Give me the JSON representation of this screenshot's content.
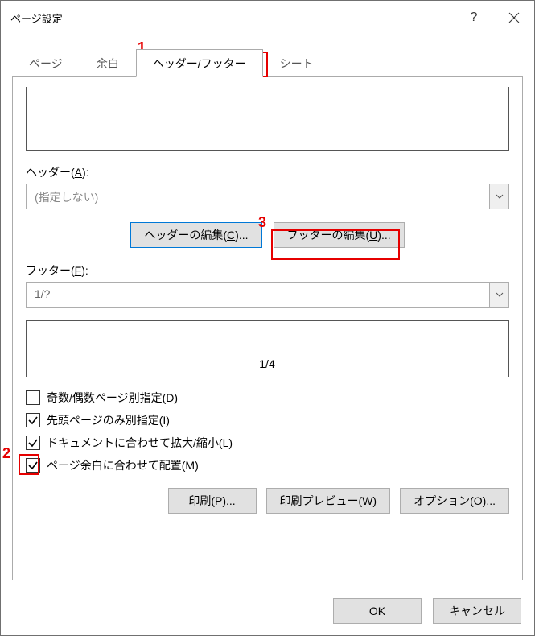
{
  "title": "ページ設定",
  "titlebar": {
    "help": "?",
    "close": "close"
  },
  "tabs": {
    "page": "ページ",
    "margin": "余白",
    "headerfooter": "ヘッダー/フッター",
    "sheet": "シート"
  },
  "header_section": {
    "label_pre": "ヘッダー(",
    "label_key": "A",
    "label_post": "):",
    "combo_value": "(指定しない)",
    "edit_header_pre": "ヘッダーの編集(",
    "edit_header_key": "C",
    "edit_header_post": ")...",
    "edit_footer_pre": "フッターの編集(",
    "edit_footer_key": "U",
    "edit_footer_post": ")..."
  },
  "footer_section": {
    "label_pre": "フッター(",
    "label_key": "F",
    "label_post": "):",
    "combo_value": "1/?",
    "preview": "1/4"
  },
  "checks": {
    "oddeven_pre": "奇数/偶数ページ別指定(",
    "oddeven_key": "D",
    "oddeven_post": ")",
    "firstpage_pre": "先頭ページのみ別指定(",
    "firstpage_key": "I",
    "firstpage_post": ")",
    "scale_pre": "ドキュメントに合わせて拡大/縮小(",
    "scale_key": "L",
    "scale_post": ")",
    "align_pre": "ページ余白に合わせて配置(",
    "align_key": "M",
    "align_post": ")"
  },
  "buttons": {
    "print_pre": "印刷(",
    "print_key": "P",
    "print_post": ")...",
    "preview_pre": "印刷プレビュー(",
    "preview_key": "W",
    "preview_post": ")",
    "options_pre": "オプション(",
    "options_key": "O",
    "options_post": ")..."
  },
  "footer_buttons": {
    "ok": "OK",
    "cancel": "キャンセル"
  },
  "annotations": {
    "n1": "1",
    "n2": "2",
    "n3": "3"
  }
}
